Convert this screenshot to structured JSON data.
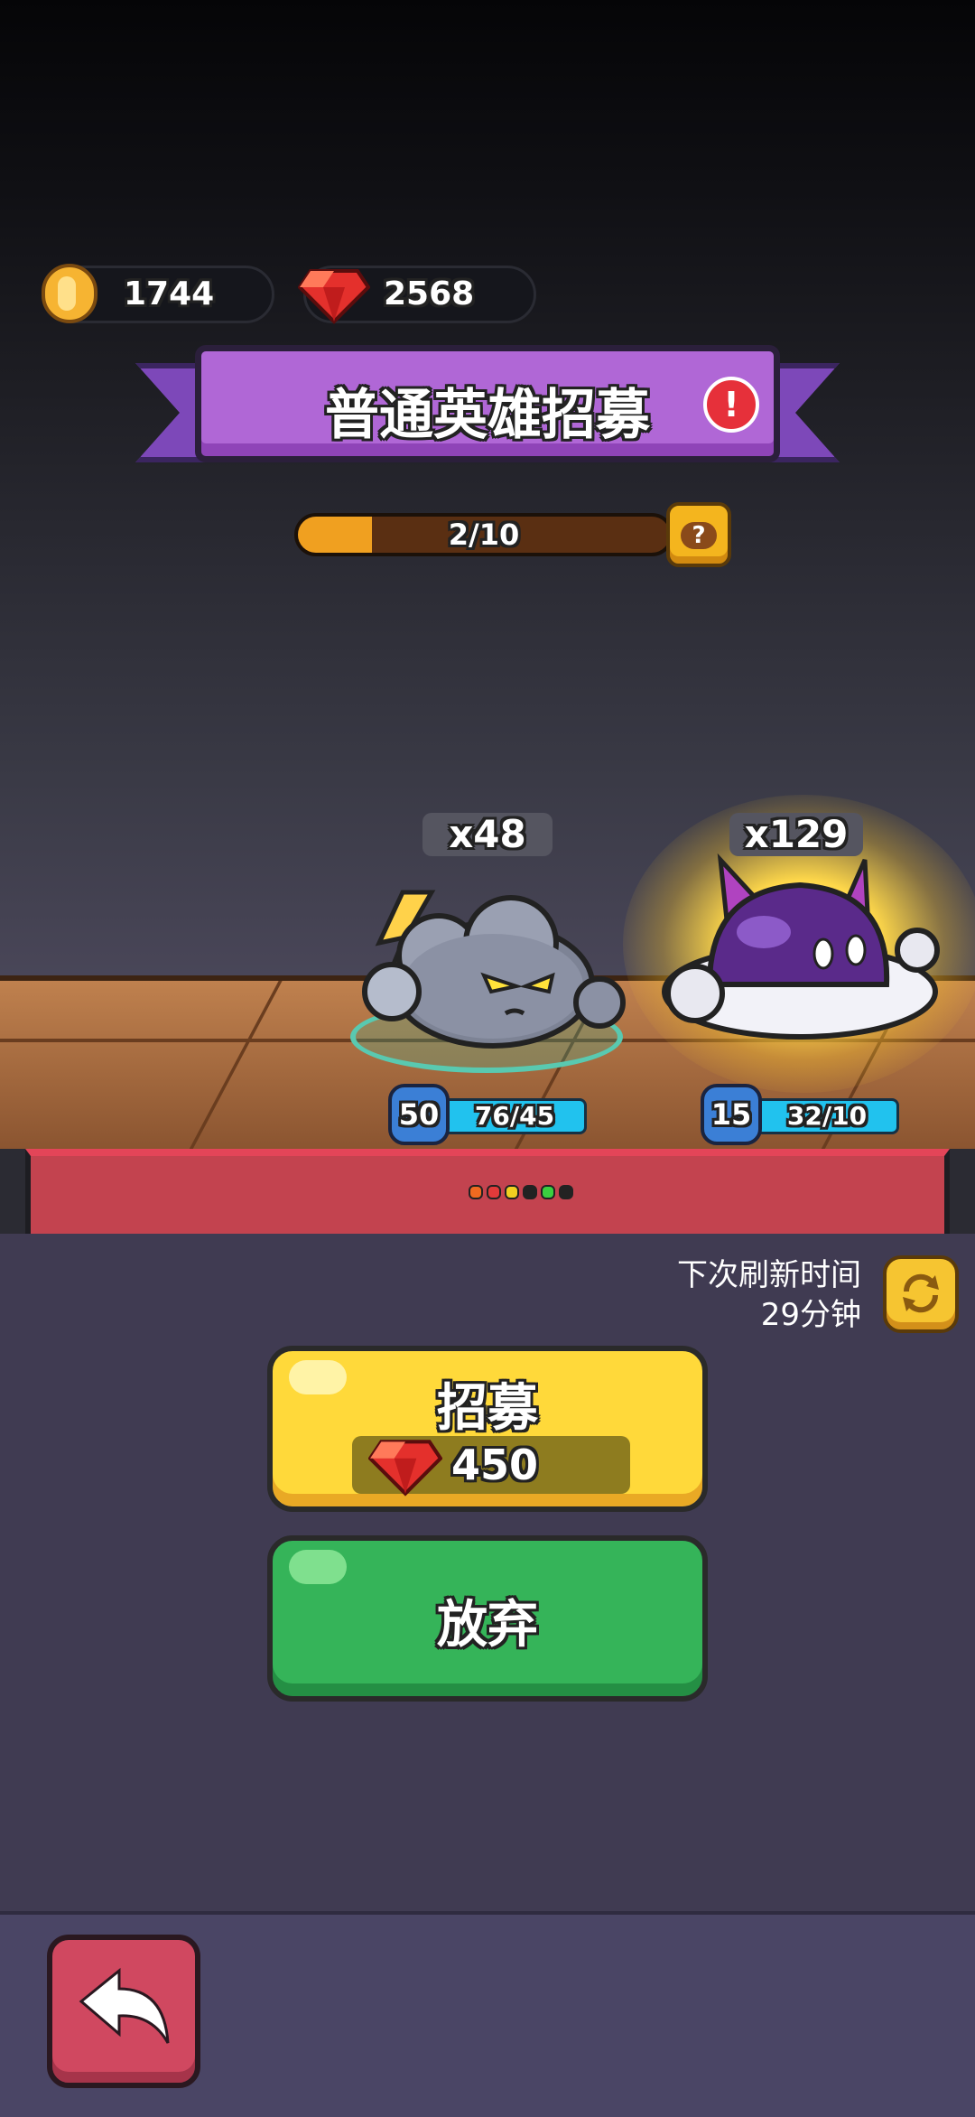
{
  "currency": {
    "gold": "1744",
    "gems": "2568"
  },
  "banner": {
    "title": "普通英雄招募"
  },
  "progress": {
    "text": "2/10",
    "fraction": 0.2
  },
  "heroes": [
    {
      "count": "x48",
      "level": "50",
      "hp": "76/45"
    },
    {
      "count": "x129",
      "level": "15",
      "hp": "32/10"
    }
  ],
  "refresh": {
    "label": "下次刷新时间",
    "time": "29分钟"
  },
  "buttons": {
    "recruit_label": "招募",
    "recruit_cost": "450",
    "abandon_label": "放弃"
  },
  "colors": {
    "gold": "#f6b432",
    "gem": "#e4302c",
    "banner": "#b067d6",
    "recruit": "#ffd93a",
    "abandon": "#35b459",
    "back": "#d04860"
  },
  "icons": [
    "gold-coin-icon",
    "gem-icon",
    "alert-icon",
    "help-icon",
    "refresh-icon",
    "back-arrow-icon"
  ]
}
